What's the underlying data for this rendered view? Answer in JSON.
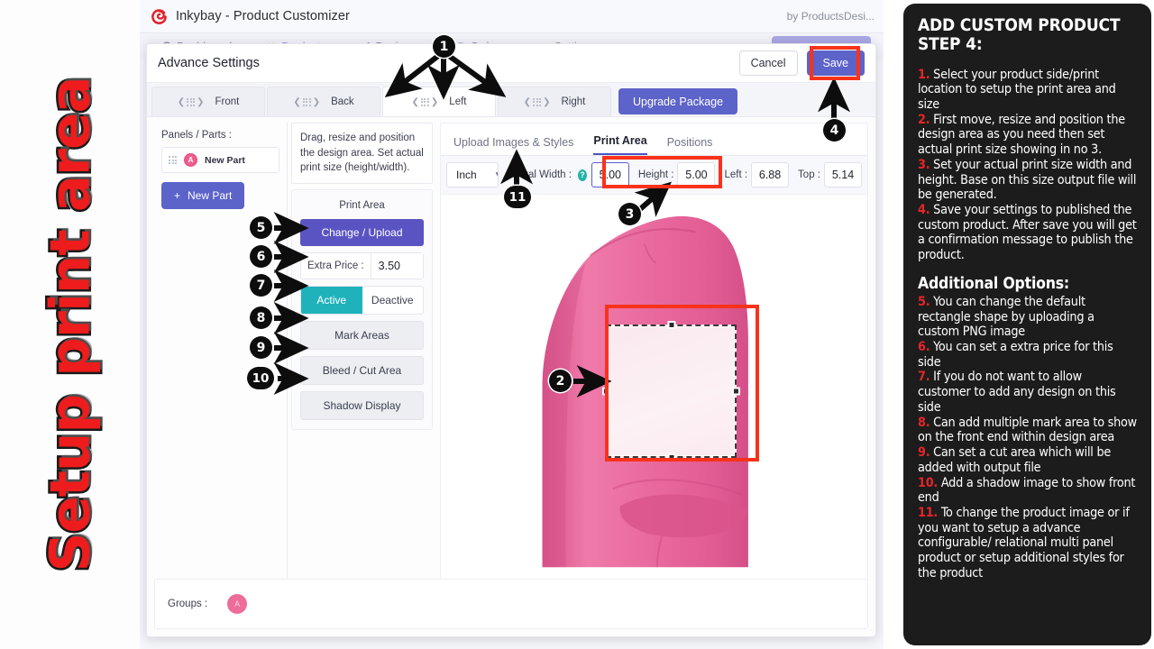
{
  "left_caption": "Setup print area",
  "app": {
    "title": "Inkybay - Product Customizer",
    "by": "by ProductsDesi...",
    "nav": [
      {
        "label": "Dashboard",
        "icon": "dashboard-icon"
      },
      {
        "label": "Products",
        "icon": "tshirt-icon"
      },
      {
        "label": "Designer",
        "icon": "pencil-icon"
      },
      {
        "label": "Orders",
        "icon": "cart-icon"
      },
      {
        "label": "Settings",
        "icon": "sliders-icon"
      }
    ]
  },
  "modal": {
    "title": "Advance Settings",
    "cancel_label": "Cancel",
    "save_label": "Save",
    "side_tabs": [
      {
        "label": "Front",
        "active": false
      },
      {
        "label": "Back",
        "active": false
      },
      {
        "label": "Left",
        "active": true
      },
      {
        "label": "Right",
        "active": false
      }
    ],
    "upgrade_label": "Upgrade Package"
  },
  "panels": {
    "label": "Panels / Parts :",
    "part_name": "New Part",
    "part_badge": "A",
    "new_part_label": "New Part",
    "plus_icon": "+"
  },
  "tools": {
    "tip": "Drag, resize and position the design area. Set actual print size (height/width).",
    "card_title": "Print Area",
    "change_upload_label": "Change / Upload",
    "extra_price_label": "Extra Price :",
    "extra_price_value": "3.50",
    "active_label": "Active",
    "deactive_label": "Deactive",
    "mark_areas_label": "Mark Areas",
    "bleed_cut_label": "Bleed / Cut Area",
    "shadow_display_label": "Shadow Display"
  },
  "canvas": {
    "tabs": [
      {
        "label": "Upload Images & Styles",
        "active": false
      },
      {
        "label": "Print Area",
        "active": true
      },
      {
        "label": "Positions",
        "active": false
      }
    ],
    "unit_value": "Inch",
    "unit_caret": "chevron-down-icon",
    "fields": [
      {
        "label": "Actual Width :",
        "value": "5.00",
        "help": true,
        "focused": true
      },
      {
        "label": "Height :",
        "value": "5.00",
        "help": false,
        "focused": false
      },
      {
        "label": "Left :",
        "value": "6.88",
        "help": false,
        "focused": false
      },
      {
        "label": "Top :",
        "value": "5.14",
        "help": false,
        "focused": false
      }
    ],
    "help_glyph": "?"
  },
  "groups": {
    "label": "Groups :",
    "chip": "A"
  },
  "annotations": {
    "badges": [
      "1",
      "2",
      "3",
      "4",
      "5",
      "6",
      "7",
      "8",
      "9",
      "10",
      "11"
    ]
  },
  "instructions": {
    "heading": "ADD CUSTOM PRODUCT\nSTEP 4:",
    "items": [
      {
        "num": "1.",
        "text": " Select your product side/print location to setup the print area and size"
      },
      {
        "num": "2.",
        "text": " First move, resize and position the  design area as you need then set actual print size showing in no 3."
      },
      {
        "num": "3.",
        "text": " Set your actual print size width and height. Base on this size output file will be generated."
      },
      {
        "num": "4.",
        "text": " Save your settings to published the custom product. After save you will get a confirmation message to publish the product."
      }
    ],
    "additional_heading": "Additional Options:",
    "additional_items": [
      {
        "num": "5.",
        "text": " You can change the default rectangle shape by uploading a custom PNG image"
      },
      {
        "num": "6.",
        "text": " You can set a extra price for this side"
      },
      {
        "num": "7.",
        "text": " If you do not want to allow customer to add any design on this side"
      },
      {
        "num": "8.",
        "text": " Can add multiple mark area to show on the front end within design area"
      },
      {
        "num": "9.",
        "text": " Can set a cut area which will be added with output file"
      },
      {
        "num": "10.",
        "text": " Add a shadow image to show front end"
      },
      {
        "num": "11.",
        "text": " To change the product image or if  you want to setup a advance configurable/ relational multi panel product or setup additional styles for the product"
      }
    ]
  },
  "colors": {
    "brand_purple": "#5c63c9",
    "accent_red": "#f9321b",
    "teal": "#20b2bb",
    "pink_shirt": "#e8669a",
    "logo_red": "#e0232b"
  }
}
